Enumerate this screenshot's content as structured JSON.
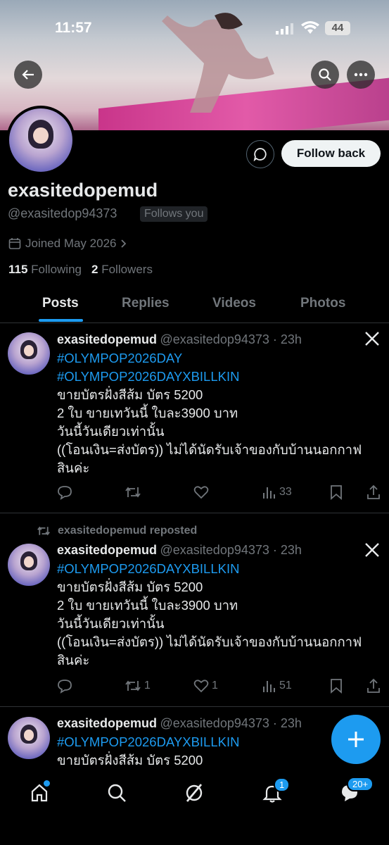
{
  "status_bar": {
    "time": "11:57",
    "battery": "44"
  },
  "profile": {
    "display_name": "exasitedopemud",
    "handle": "@exasitedop94373",
    "follows_you": "Follows you",
    "joined": "Joined May 2026",
    "following_count": "115",
    "following_label": "Following",
    "followers_count": "2",
    "followers_label": "Followers",
    "follow_back_label": "Follow back"
  },
  "tabs": [
    "Posts",
    "Replies",
    "Videos",
    "Photos"
  ],
  "posts": [
    {
      "name": "exasitedopemud",
      "handle": "@exasitedop94373 · 23h",
      "hashtags": [
        "#OLYMPOP2026DAY",
        "#OLYMPOP2026DAYXBILLKIN"
      ],
      "lines": [
        "ขายบัตรฝั่งสีส้ม บัตร 5200",
        "2 ใบ ขายเทวันนี้ ใบละ3900 บาท",
        "วันนี้วันเดียวเท่านั้น",
        "((โอนเงิน=ส่งบัตร)) ไม่ได้นัดรับเจ้าของกับบ้านนอกกาฟ",
        "สินค่ะ"
      ],
      "reposts": "",
      "likes": "",
      "views": "33"
    },
    {
      "repost_label": "exasitedopemud reposted",
      "name": "exasitedopemud",
      "handle": "@exasitedop94373 · 23h",
      "hashtags": [
        "#OLYMPOP2026DAYXBILLKIN"
      ],
      "lines": [
        "ขายบัตรฝั่งสีส้ม บัตร 5200",
        "2 ใบ ขายเทวันนี้ ใบละ3900 บาท",
        "วันนี้วันเดียวเท่านั้น",
        "((โอนเงิน=ส่งบัตร)) ไม่ได้นัดรับเจ้าของกับบ้านนอกกาฟ",
        "สินค่ะ"
      ],
      "reposts": "1",
      "likes": "1",
      "views": "51"
    },
    {
      "name": "exasitedopemud",
      "handle": "@exasitedop94373 · 23h",
      "hashtags": [
        "#OLYMPOP2026DAYXBILLKIN"
      ],
      "lines": [
        "ขายบัตรฝั่งสีส้ม บัตร 5200"
      ]
    }
  ],
  "nav": {
    "notifications_badge": "1",
    "messages_badge": "20+"
  },
  "colors": {
    "accent": "#1d9bf0",
    "muted": "#71767b",
    "background": "#000000"
  }
}
